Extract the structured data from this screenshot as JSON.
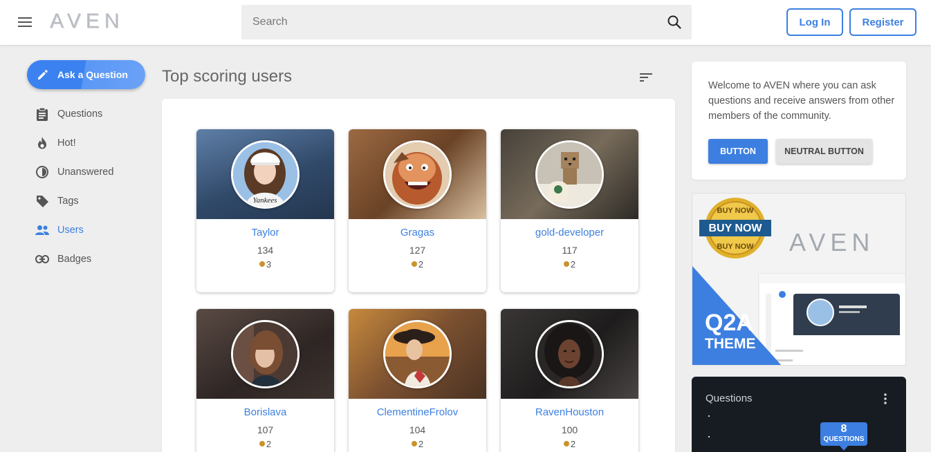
{
  "header": {
    "logo": "AVEN",
    "search_placeholder": "Search",
    "login_label": "Log In",
    "register_label": "Register"
  },
  "sidebar": {
    "ask_label": "Ask a Question",
    "items": [
      {
        "label": "Questions",
        "icon": "clipboard-icon"
      },
      {
        "label": "Hot!",
        "icon": "fire-icon"
      },
      {
        "label": "Unanswered",
        "icon": "half-circle-icon"
      },
      {
        "label": "Tags",
        "icon": "tag-icon"
      },
      {
        "label": "Users",
        "icon": "users-icon",
        "active": true
      },
      {
        "label": "Badges",
        "icon": "link-icon"
      }
    ]
  },
  "main": {
    "title": "Top scoring users",
    "users": [
      {
        "name": "Taylor",
        "points": "134",
        "badges": "3"
      },
      {
        "name": "Gragas",
        "points": "127",
        "badges": "2"
      },
      {
        "name": "gold-developer",
        "points": "117",
        "badges": "2"
      },
      {
        "name": "Borislava",
        "points": "107",
        "badges": "2"
      },
      {
        "name": "ClementineFrolov",
        "points": "104",
        "badges": "2"
      },
      {
        "name": "RavenHouston",
        "points": "100",
        "badges": "2"
      }
    ]
  },
  "right": {
    "welcome_text": "Welcome to AVEN where you can ask questions and receive answers from other members of the community.",
    "button_label": "BUTTON",
    "neutral_button_label": "NEUTRAL BUTTON",
    "promo": {
      "badge_top": "BUY NOW",
      "badge_main": "BUY NOW",
      "badge_bottom": "BUY NOW",
      "logo": "AVEN",
      "q2a": "Q2A",
      "theme": "THEME"
    },
    "questions_widget": {
      "title": "Questions",
      "count": "8",
      "count_label": "QUESTIONS"
    }
  },
  "colors": {
    "accent": "#3c7fe0",
    "badge_gold": "#c9922b",
    "background": "#eeeeee",
    "dark_widget": "#171c22"
  }
}
